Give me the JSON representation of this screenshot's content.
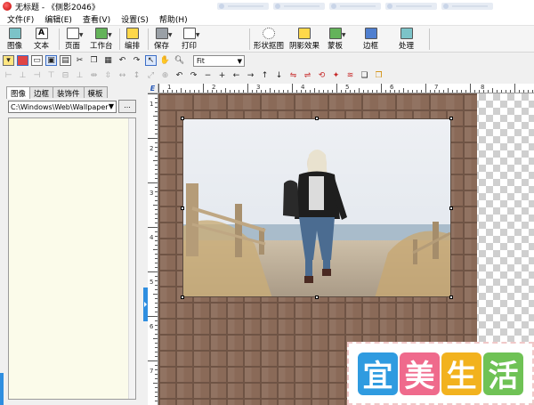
{
  "titlebar": {
    "title": "无标题 - 《侧影2046》"
  },
  "menu": [
    "文件(F)",
    "编辑(E)",
    "查看(V)",
    "设置(S)",
    "帮助(H)"
  ],
  "toolbar_main": {
    "image": "图像",
    "text": "文本",
    "page": "页面",
    "workbench": "工作台",
    "arrange": "编排",
    "save": "保存",
    "print": "打印",
    "shape_cutout": "形状抠图",
    "shadow_effect": "阴影效果",
    "template": "蒙板",
    "border": "边框",
    "process": "处理"
  },
  "toolbar_small": {
    "zoom_value": "Fit"
  },
  "left_panel": {
    "tabs": [
      "图像",
      "边框",
      "装饰件",
      "模板"
    ],
    "path": "C:\\Windows\\Web\\Wallpaper",
    "browse_label": "..."
  },
  "ruler": {
    "corner": "E",
    "h_labels": [
      "1",
      "2",
      "3",
      "4",
      "5",
      "6",
      "7",
      "8"
    ],
    "v_labels": [
      "1",
      "2",
      "3",
      "4",
      "5",
      "6",
      "7"
    ]
  },
  "watermark": {
    "chars": [
      "宜",
      "美",
      "生",
      "活"
    ],
    "colors": [
      "#2f9be0",
      "#ef6a8c",
      "#f2b21e",
      "#6fc255"
    ]
  },
  "colors": {
    "accent_blue": "#2f8ee0",
    "brick": "#8a6a58",
    "thumb_bg": "#fbfbea"
  }
}
